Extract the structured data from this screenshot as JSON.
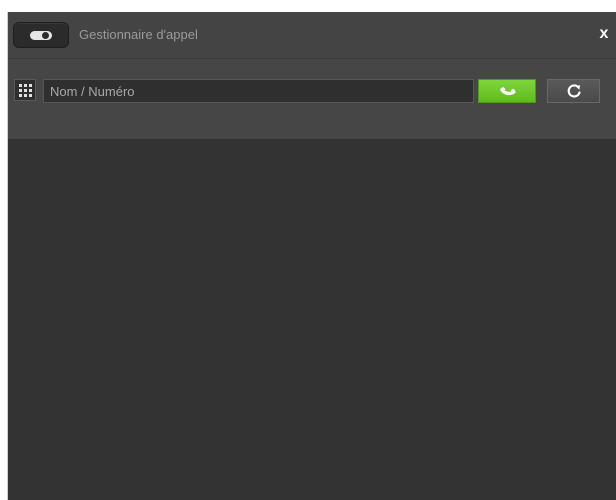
{
  "window": {
    "title": "Gestionnaire d'appel",
    "close_label": "x"
  },
  "toolbar": {
    "search": {
      "placeholder": "Nom / Numéro",
      "value": ""
    },
    "icons": {
      "toggle": "toggle-switch-icon",
      "dialpad": "dialpad-grid-icon",
      "call": "phone-call-icon",
      "refresh": "refresh-icon"
    }
  },
  "colors": {
    "window_bg": "#333333",
    "titlebar_bg": "#444444",
    "toolbar_bg": "#464646",
    "call_accent": "#6cc62a",
    "title_text": "#9a9a9a"
  }
}
